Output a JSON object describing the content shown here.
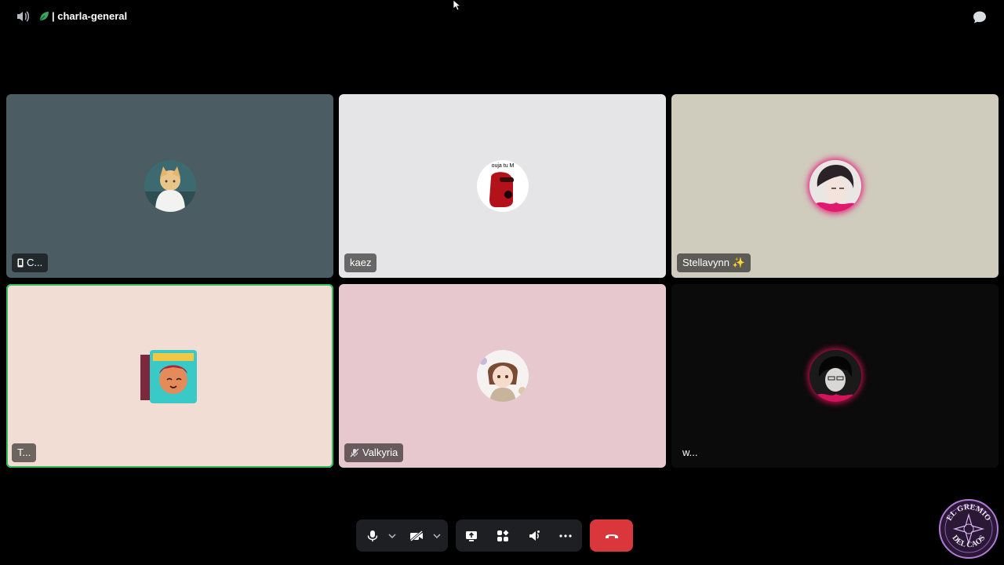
{
  "header": {
    "channel_name": "| charla-general",
    "speaker_icon": "speaker-icon",
    "channel_icon": "leaf-channel-icon",
    "chat_icon": "chat-bubble-icon"
  },
  "tiles": [
    {
      "name": "C...",
      "bg": "#4b5c63",
      "badge_icon": "mobile-phone-icon"
    },
    {
      "name": "kaez",
      "bg": "#e5e4e6",
      "avatar_text": "ouja tu M"
    },
    {
      "name": "Stellavynn ✨",
      "bg": "#cfcbbd"
    },
    {
      "name": "T...",
      "bg": "#f1ddd4",
      "speaking": true
    },
    {
      "name": "Valkyria",
      "bg": "#e7c8ce",
      "badge_icon": "muted-mic-icon"
    },
    {
      "name": "w...",
      "bg": "#0b0b0b"
    }
  ],
  "controls": {
    "items": [
      "microphone-icon",
      "chevron-down-icon",
      "camera-off-icon",
      "chevron-down-icon",
      "screen-share-icon",
      "activities-icon",
      "soundboard-icon",
      "more-options-icon",
      "hang-up-icon"
    ],
    "hangup_color": "#da373c"
  },
  "logo": {
    "text_top": "EL GREMIO",
    "text_bottom": "DEL CAOS"
  }
}
